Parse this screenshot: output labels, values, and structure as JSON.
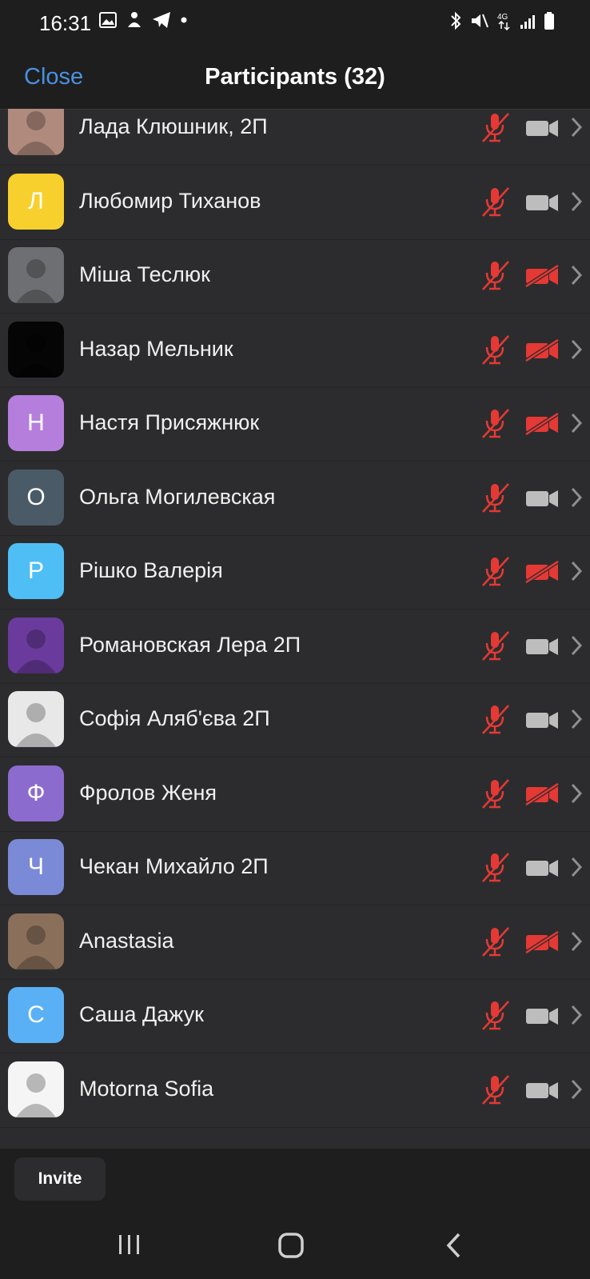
{
  "status": {
    "time": "16:31"
  },
  "header": {
    "close_label": "Close",
    "title": "Participants (32)"
  },
  "participants": [
    {
      "name": "Лада Клюшник, 2П",
      "avatar": "photo",
      "avatar_color": "#b08a7d",
      "mic": "muted",
      "video": "off"
    },
    {
      "name": "Любомир Тиханов",
      "avatar": "Л",
      "avatar_color": "#f7d02d",
      "mic": "muted",
      "video": "off"
    },
    {
      "name": "Міша Теслюк",
      "avatar": "photo",
      "avatar_color": "#6d6f72",
      "mic": "muted",
      "video": "stopped"
    },
    {
      "name": "Назар Мельник",
      "avatar": "photo",
      "avatar_color": "#050505",
      "mic": "muted",
      "video": "stopped"
    },
    {
      "name": "Настя Присяжнюк",
      "avatar": "Н",
      "avatar_color": "#b57edc",
      "mic": "muted",
      "video": "stopped"
    },
    {
      "name": "Ольга Могилевская",
      "avatar": "О",
      "avatar_color": "#4a5a67",
      "mic": "muted",
      "video": "off"
    },
    {
      "name": "Рішко Валерія",
      "avatar": "Р",
      "avatar_color": "#4fbef5",
      "mic": "muted",
      "video": "stopped"
    },
    {
      "name": "Романовская Лера 2П",
      "avatar": "photo",
      "avatar_color": "#6a3b9c",
      "mic": "muted",
      "video": "off"
    },
    {
      "name": "Софія Аляб'єва 2П",
      "avatar": "photo",
      "avatar_color": "#e8e8e8",
      "mic": "muted",
      "video": "off"
    },
    {
      "name": "Фролов Женя",
      "avatar": "Ф",
      "avatar_color": "#8c6bce",
      "mic": "muted",
      "video": "stopped"
    },
    {
      "name": "Чекан Михайло 2П",
      "avatar": "Ч",
      "avatar_color": "#7b8ad6",
      "mic": "muted",
      "video": "off"
    },
    {
      "name": "Anastasia",
      "avatar": "photo",
      "avatar_color": "#8a6f5a",
      "mic": "muted",
      "video": "stopped"
    },
    {
      "name": "Саша Дажук",
      "avatar": "С",
      "avatar_color": "#5ab0f5",
      "mic": "muted",
      "video": "off"
    },
    {
      "name": "Motorna Sofia",
      "avatar": "photo",
      "avatar_color": "#f5f5f5",
      "mic": "muted",
      "video": "off"
    }
  ],
  "footer": {
    "invite_label": "Invite"
  },
  "colors": {
    "muted_red": "#e53935",
    "cam_gray": "#bdbdbd",
    "accent_blue": "#4a90e2"
  }
}
